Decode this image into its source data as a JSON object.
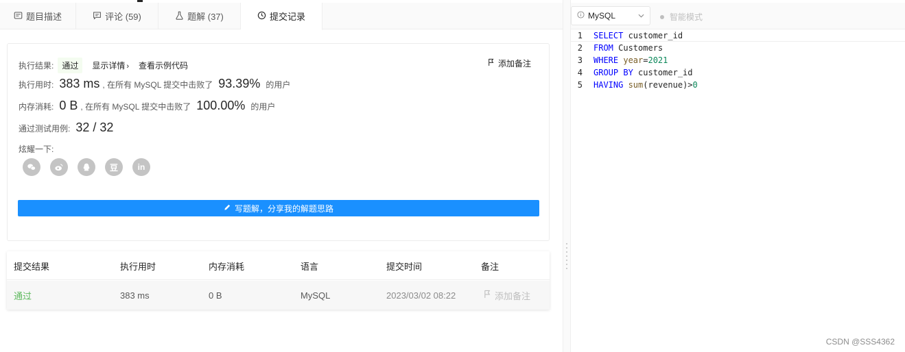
{
  "tabs": [
    {
      "label": "题目描述",
      "icon": "description-icon"
    },
    {
      "label": "评论 (59)",
      "icon": "comment-icon"
    },
    {
      "label": "题解 (37)",
      "icon": "flask-icon"
    },
    {
      "label": "提交记录",
      "icon": "clock-icon",
      "active": true
    }
  ],
  "result": {
    "label": "执行结果:",
    "status": "通过",
    "detail_link": "显示详情",
    "example_link": "查看示例代码",
    "add_note": "添加备注",
    "runtime_label": "执行用时:",
    "runtime_value": "383 ms",
    "runtime_text": ", 在所有 MySQL 提交中击败了",
    "runtime_pct": "93.39%",
    "users_text": "的用户",
    "memory_label": "内存消耗:",
    "memory_value": "0 B",
    "memory_text": ", 在所有 MySQL 提交中击败了",
    "memory_pct": "100.00%",
    "cases_label": "通过测试用例:",
    "cases_value": "32 / 32",
    "share_label": "炫耀一下:",
    "share_button": "写题解，分享我的解题思路"
  },
  "share_icons": [
    "wechat-icon",
    "weibo-icon",
    "qq-icon",
    "douban-icon",
    "linkedin-icon"
  ],
  "table": {
    "headers": [
      "提交结果",
      "执行用时",
      "内存消耗",
      "语言",
      "提交时间",
      "备注"
    ],
    "rows": [
      [
        "通过",
        "383 ms",
        "0 B",
        "MySQL",
        "2023/03/02 08:22",
        "添加备注"
      ]
    ]
  },
  "editor": {
    "language": "MySQL",
    "smart_mode": "智能模式",
    "line_numbers": [
      "1",
      "2",
      "3",
      "4",
      "5"
    ],
    "lines": [
      {
        "k": "SELECT",
        "rest": " customer_id"
      },
      {
        "k": "FROM",
        "rest": " Customers"
      },
      {
        "k": "WHERE",
        "col": " year",
        "op": "=",
        "num": "2021"
      },
      {
        "k": "GROUP BY",
        "rest": " customer_id"
      },
      {
        "k": "HAVING",
        "fn": " sum",
        "rest": "(revenue)>",
        "num": "0"
      }
    ]
  },
  "watermark": "CSDN @SSS4362"
}
